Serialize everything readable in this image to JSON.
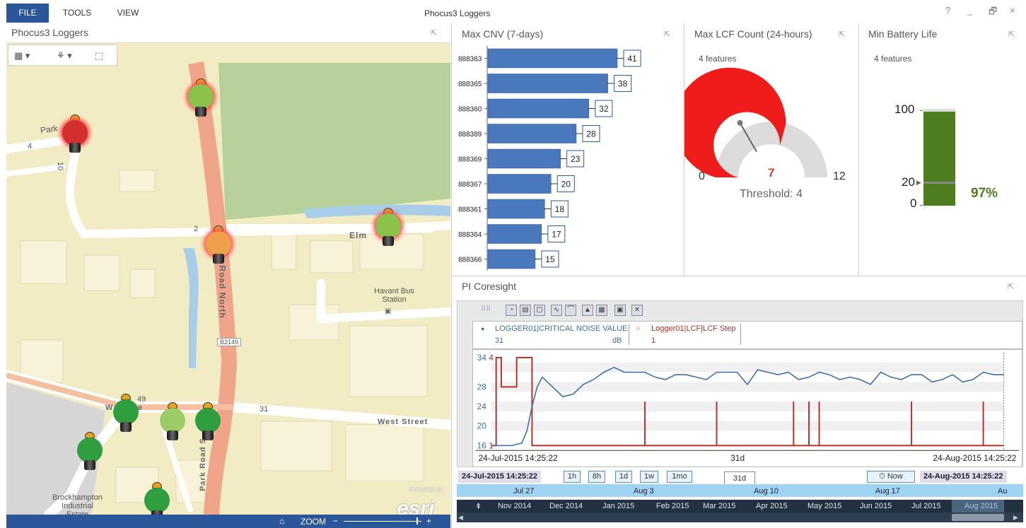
{
  "menu": {
    "file": "FILE",
    "tools": "TOOLS",
    "view": "VIEW"
  },
  "window": {
    "title": "Phocus3 Loggers",
    "help": "?",
    "minimize": "_",
    "restore": "🗗",
    "close": "×"
  },
  "map_panel": {
    "title": "Phocus3 Loggers",
    "labels": {
      "park": "Park",
      "elm": "Elm",
      "road_north": "Road North",
      "park_road_south": "Park Road S",
      "havant_bus_station": "Havant Bus\nStation",
      "b2149": "B2149",
      "west_street_1": "West Street",
      "west_street_2": "W    Stre",
      "brockhampton": "Brockhampton\nIndustrial\nEstate",
      "num_4": "4",
      "num_10": "10",
      "num_2": "2",
      "num_31": "31",
      "num_49": "49"
    },
    "footer": {
      "home": "⌂",
      "zoom_label": "ZOOM",
      "zoom_minus": "−",
      "zoom_plus": "+"
    },
    "attribution": {
      "powered": "POWERED BY",
      "brand": "esri"
    },
    "markers": [
      {
        "color": "#8bc34a"
      },
      {
        "color": "#d32f2f"
      },
      {
        "color": "#8bc34a"
      },
      {
        "color": "#f0a04b"
      },
      {
        "color": "#2e9e3e"
      },
      {
        "color": "#9ccc65"
      },
      {
        "color": "#2e9e3e"
      },
      {
        "color": "#2e9e3e"
      },
      {
        "color": "#2e9e3e"
      }
    ]
  },
  "cnv_panel": {
    "title": "Max CNV (7-days)",
    "chart_data": {
      "type": "bar",
      "orientation": "horizontal",
      "categories": [
        "888363",
        "888365",
        "888360",
        "888389",
        "888369",
        "888367",
        "888361",
        "888364",
        "888366"
      ],
      "values": [
        41,
        38,
        32,
        28,
        23,
        20,
        18,
        17,
        15
      ],
      "xlim": [
        0,
        45
      ],
      "bar_color": "#4a78bd"
    }
  },
  "lcf_panel": {
    "title": "Max LCF Count (24-hours)",
    "features": "4 features",
    "gauge": {
      "min": "0",
      "max": "12",
      "value": "7",
      "value_num": 7,
      "max_num": 12,
      "threshold_label": "Threshold: 4",
      "threshold_num": 4
    }
  },
  "battery_panel": {
    "title": "Min Battery Life",
    "features": "4 features",
    "scale": {
      "top": "100",
      "mid": "20",
      "bottom": "0"
    },
    "value_label": "97%",
    "value_fraction": 0.97
  },
  "coresight": {
    "title": "PI Coresight",
    "legend": {
      "series1_name": "LOGGER01|CRITICAL NOISE VALUE",
      "series1_value": "31",
      "series1_unit": "dB",
      "series2_name": "Logger01|LCF|LCF Step",
      "series2_value": "1"
    },
    "axis": {
      "y_labels_left": [
        "34",
        "28",
        "24",
        "20",
        "16"
      ],
      "y_labels_red": [
        "4",
        "1"
      ],
      "start": "24-Jul-2015 14:25:22",
      "mid": "31d",
      "end": "24-Aug-2015 14:25:22"
    },
    "chart_data": {
      "type": "line",
      "x": [
        0,
        2,
        4,
        6,
        7,
        8,
        9,
        10,
        12,
        14,
        16,
        18,
        20,
        22,
        24,
        25,
        26,
        28,
        30,
        32,
        34,
        36,
        38,
        40,
        42,
        44,
        46,
        48,
        50,
        51,
        52,
        54,
        56,
        58,
        60,
        62,
        64,
        66,
        68,
        70,
        72,
        74,
        76,
        78,
        80,
        82,
        84,
        86,
        88,
        90,
        92,
        94,
        96,
        98,
        100
      ],
      "series": [
        {
          "name": "LOGGER01|CRITICAL NOISE VALUE",
          "color": "#3d6fb0",
          "values": [
            16,
            16,
            16,
            16.5,
            19,
            24,
            28,
            30,
            28,
            26,
            26.5,
            28.5,
            29.5,
            31,
            32,
            31.5,
            31,
            31,
            31,
            30,
            29.5,
            30.5,
            30.5,
            30,
            29.5,
            31,
            31,
            31,
            28.5,
            30,
            31.5,
            31,
            30.5,
            31,
            29.5,
            30,
            31,
            30.5,
            29.5,
            30,
            29.5,
            28.5,
            31,
            30,
            29.5,
            30.5,
            30.5,
            29,
            29.5,
            30.5,
            29,
            29.5,
            31,
            30.5,
            30.5
          ]
        },
        {
          "name": "Logger01|LCF|LCF Step",
          "color": "#b8322a",
          "steps": [
            [
              0,
              1
            ],
            [
              1,
              1
            ],
            [
              1,
              4
            ],
            [
              2,
              4
            ],
            [
              2,
              3
            ],
            [
              5,
              3
            ],
            [
              5,
              4
            ],
            [
              8,
              4
            ],
            [
              8,
              1
            ],
            [
              100,
              1
            ]
          ],
          "spikes": [
            30,
            44,
            59,
            62,
            64,
            82,
            96
          ]
        }
      ],
      "ylim": [
        15,
        35
      ]
    },
    "time_buttons": [
      "1h",
      "8h",
      "1d",
      "1w",
      "1mo"
    ],
    "start_time": "24-Jul-2015 14:25:22",
    "end_time": "24-Aug-2015 14:25:22",
    "now_label": "Now",
    "range_tab": "31d",
    "timeline_days": [
      "Jul 27",
      "Aug 3",
      "Aug 10",
      "Aug 17",
      "Au"
    ],
    "timeline_months": [
      "Nov 2014",
      "Dec 2014",
      "Jan 2015",
      "Feb 2015",
      "Mar 2015",
      "Apr 2015",
      "May 2015",
      "Jun 2015",
      "Jul 2015",
      "Aug 2015"
    ]
  },
  "pin_icon": "⇱"
}
